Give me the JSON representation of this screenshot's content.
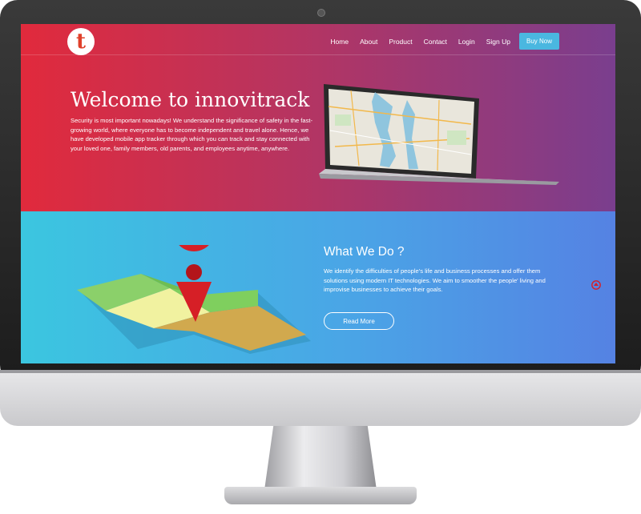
{
  "header": {
    "logo_letter": "t",
    "nav": [
      "Home",
      "About",
      "Product",
      "Contact",
      "Login",
      "Sign Up"
    ],
    "buy_label": "Buy Now"
  },
  "hero": {
    "title": "Welcome to innovitrack",
    "text": "Security is most important nowadays! We understand the significance of safety in the fast-growing world, where everyone has to become independent and travel alone. Hence, we have developed mobile app tracker through which you can track and stay connected with your loved one, family members, old parents, and employees anytime, anywhere."
  },
  "what_we_do": {
    "title": "What We Do ?",
    "text": "We identify the difficulties of people's life and business processes and offer them solutions using modern IT technologies. We aim to smoother the people' living and improvise businesses to achieve their goals.",
    "button_label": "Read More"
  },
  "colors": {
    "hero_start": "#e12a3c",
    "hero_end": "#7a3e8e",
    "section_start": "#3bc6e0",
    "section_end": "#5582e3",
    "buy_button": "#4ab7e0",
    "pin": "#d61f26"
  },
  "icons": [
    "logo-icon",
    "laptop-map-image",
    "map-pin-illustration",
    "scroll-to-top-icon",
    "webcam-icon"
  ]
}
